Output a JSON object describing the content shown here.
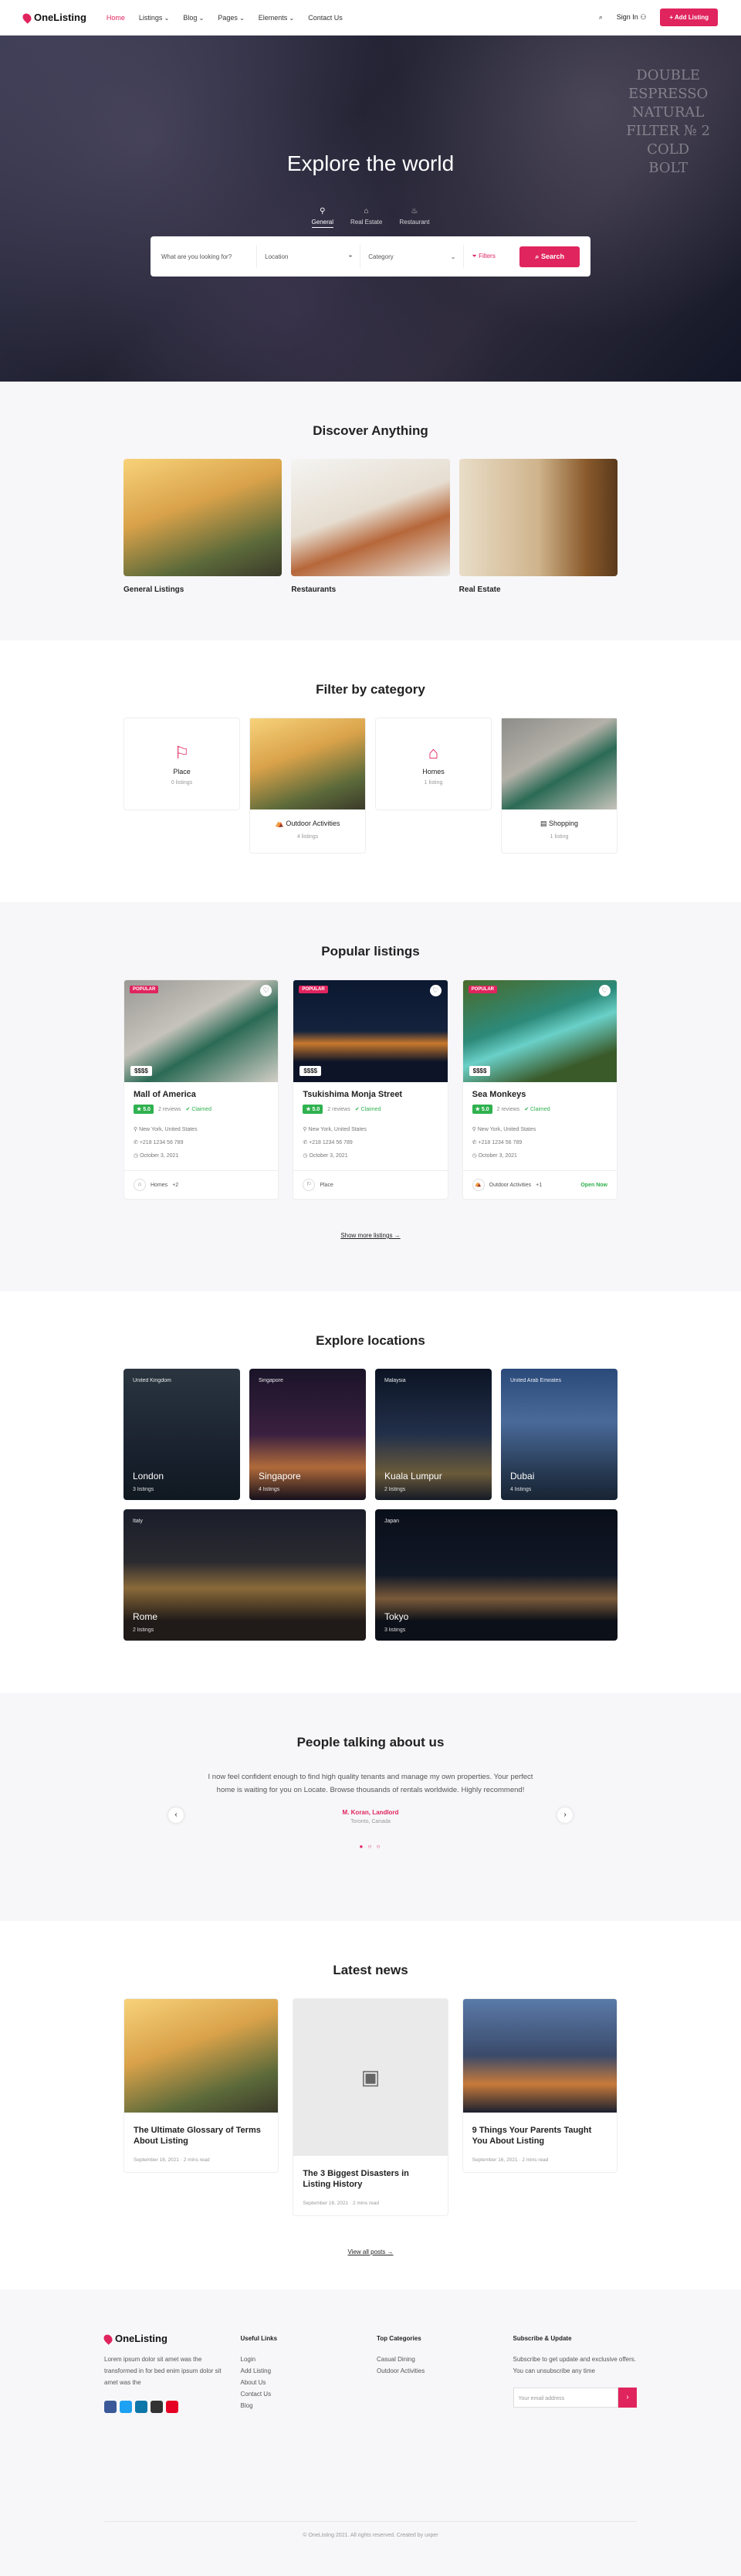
{
  "header": {
    "logo": "OneListing",
    "nav": [
      "Home",
      "Listings",
      "Blog",
      "Pages",
      "Elements",
      "Contact Us"
    ],
    "sign_in": "Sign In",
    "add_listing": "+ Add Listing"
  },
  "hero": {
    "title": "Explore the world",
    "chalkboard": "DOUBLE ESPRESSO NATURAL FILTER № 2 COLD BOLT",
    "tabs": [
      "General",
      "Real Estate",
      "Restaurant"
    ],
    "search_placeholder": "What are you looking for?",
    "location_placeholder": "Location",
    "category_placeholder": "Category",
    "filters_label": "Filters",
    "search_button": "Search"
  },
  "discover": {
    "title": "Discover Anything",
    "cards": [
      "General Listings",
      "Restaurants",
      "Real Estate"
    ]
  },
  "filter": {
    "title": "Filter by category",
    "cards": [
      {
        "name": "Place",
        "count": "0 listings"
      },
      {
        "name": "Outdoor Activities",
        "count": "4 listings"
      },
      {
        "name": "Homes",
        "count": "1 listing"
      },
      {
        "name": "Shopping",
        "count": "1 listing"
      }
    ]
  },
  "popular": {
    "title": "Popular listings",
    "badge": "POPULAR",
    "listings": [
      {
        "title": "Mall of America",
        "price": "$$$$",
        "rating": "★ 5.0",
        "reviews": "2 reviews",
        "claimed": "Claimed",
        "location": "New York, United States",
        "phone": "+218 1234 56 789",
        "date": "October 3, 2021",
        "category": "Homes",
        "extra": "+2",
        "status": ""
      },
      {
        "title": "Tsukishima Monja Street",
        "price": "$$$$",
        "rating": "★ 5.0",
        "reviews": "2 reviews",
        "claimed": "Claimed",
        "location": "New York, United States",
        "phone": "+218 1234 56 789",
        "date": "October 3, 2021",
        "category": "Place",
        "extra": "",
        "status": ""
      },
      {
        "title": "Sea Monkeys",
        "price": "$$$$",
        "rating": "★ 5.0",
        "reviews": "2 reviews",
        "claimed": "Claimed",
        "location": "New York, United States",
        "phone": "+218 1234 56 789",
        "date": "October 3, 2021",
        "category": "Outdoor Activities",
        "extra": "+1",
        "status": "Open Now"
      }
    ],
    "more_link": "Show more listings →"
  },
  "explore": {
    "title": "Explore locations",
    "locations": [
      {
        "country": "United Kingdom",
        "city": "London",
        "count": "3 listings"
      },
      {
        "country": "Singapore",
        "city": "Singapore",
        "count": "4 listings"
      },
      {
        "country": "Malaysia",
        "city": "Kuala Lumpur",
        "count": "2 listings"
      },
      {
        "country": "United Arab Emirates",
        "city": "Dubai",
        "count": "4 listings"
      },
      {
        "country": "Italy",
        "city": "Rome",
        "count": "2 listings"
      },
      {
        "country": "Japan",
        "city": "Tokyo",
        "count": "3 listings"
      }
    ]
  },
  "testimonials": {
    "title": "People talking about us",
    "quote": "I now feel confident enough to find high quality tenants and manage my own properties. Your perfect home is waiting for you on Locate. Browse thousands of rentals worldwide. Highly recommend!",
    "author": "M. Koran, Landlord",
    "location": "Toronto, Canada"
  },
  "news": {
    "title": "Latest news",
    "posts": [
      {
        "title": "The Ultimate Glossary of Terms About Listing",
        "date": "September 16, 2021",
        "read": "2 mins read"
      },
      {
        "title": "The 3 Biggest Disasters in Listing History",
        "date": "September 16, 2021",
        "read": "2 mins read"
      },
      {
        "title": "9 Things Your Parents Taught You About Listing",
        "date": "September 16, 2021",
        "read": "2 mins read"
      }
    ],
    "all_link": "View all posts →"
  },
  "footer": {
    "about": "Lorem ipsum dolor sit amet was the transformed in for bed enim ipsum dolor sit amet was the",
    "useful_title": "Useful Links",
    "useful_links": [
      "Login",
      "Add Listing",
      "About Us",
      "Contact Us",
      "Blog"
    ],
    "top_title": "Top Categories",
    "top_links": [
      "Casual Dining",
      "Outdoor Activities"
    ],
    "subscribe_title": "Subscribe & Update",
    "subscribe_text": "Subscribe to get update and exclusive offers. You can unsubscribe any time",
    "email_placeholder": "Your email address",
    "copyright": "© OneListing 2021. All rights reserved. Created by uxper"
  },
  "colors": {
    "accent": "#e0245e",
    "success": "#2fb14f"
  }
}
